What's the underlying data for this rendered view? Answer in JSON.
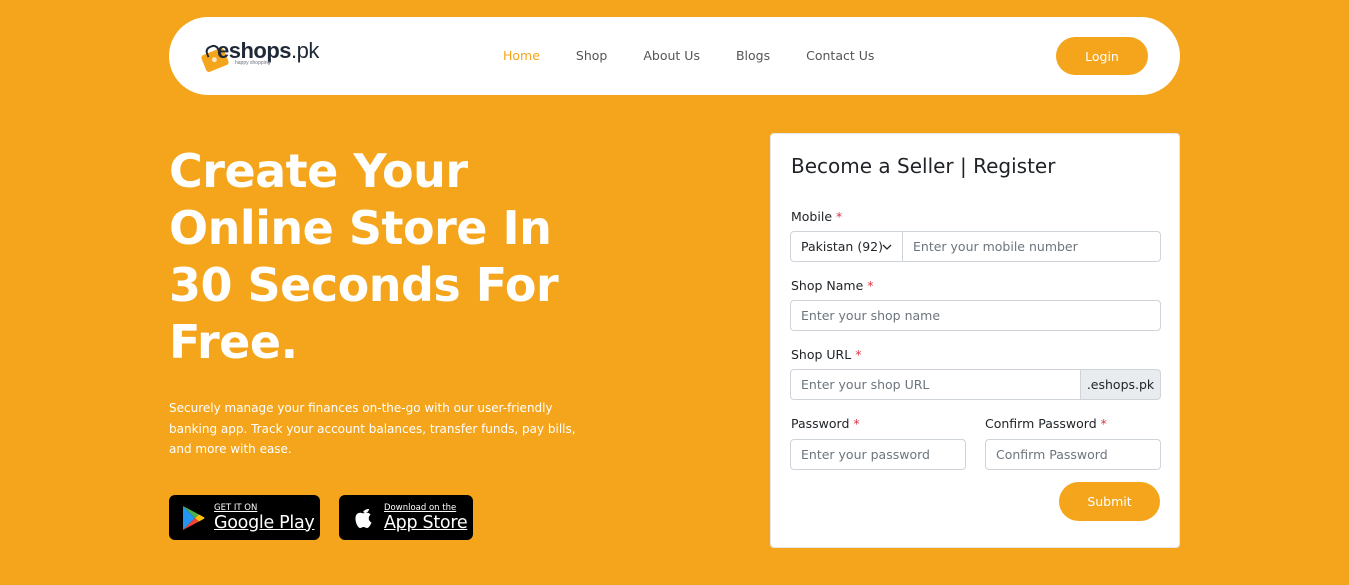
{
  "brand": {
    "logo_main": "eshops",
    "logo_suffix": ".pk",
    "logo_tagline": "happy shopping"
  },
  "nav": {
    "links": [
      {
        "label": "Home",
        "active": true
      },
      {
        "label": "Shop",
        "active": false
      },
      {
        "label": "About Us",
        "active": false
      },
      {
        "label": "Blogs",
        "active": false
      },
      {
        "label": "Contact Us",
        "active": false
      }
    ],
    "login_label": "Login"
  },
  "hero": {
    "title_lines": [
      "Create Your",
      "Online Store In",
      "30 Seconds For",
      "Free."
    ],
    "description": "Securely manage your finances on-the-go with our user-friendly banking app. Track your account balances, transfer funds, pay bills, and more with ease.",
    "google_play": {
      "small": "GET IT ON",
      "big": "Google Play",
      "icon": "google-play-icon"
    },
    "app_store": {
      "small": "Download on the",
      "big": "App Store",
      "icon": "apple-icon"
    }
  },
  "form": {
    "title": "Become a Seller | Register",
    "required_mark": "*",
    "mobile": {
      "label": "Mobile",
      "country": "Pakistan (92)",
      "placeholder": "Enter your mobile number"
    },
    "shop_name": {
      "label": "Shop Name",
      "placeholder": "Enter your shop name"
    },
    "shop_url": {
      "label": "Shop URL",
      "placeholder": "Enter your shop URL",
      "suffix": ".eshops.pk"
    },
    "password": {
      "label": "Password",
      "placeholder": "Enter your password"
    },
    "confirm_password": {
      "label": "Confirm Password",
      "placeholder": "Confirm Password"
    },
    "submit_label": "Submit"
  },
  "colors": {
    "accent": "#F4A51C",
    "required": "#dc3545",
    "background": "#F4A51C"
  }
}
